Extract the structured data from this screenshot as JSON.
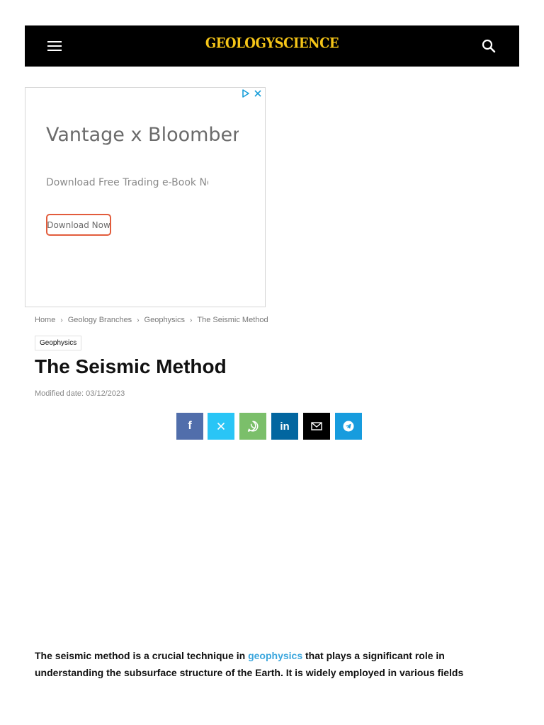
{
  "header": {
    "logo": "GEOLOGYSCIENCE",
    "menu_icon": "hamburger-menu-icon",
    "search_icon": "search-icon",
    "background": "#000000",
    "logo_color": "#f5c518"
  },
  "ad": {
    "title": "Vantage x Bloomberg Media Studios",
    "subtitle": "Download Free Trading e-Book Now",
    "button_label": "Download Now",
    "adchoices_icon": "adchoices-icon",
    "close_icon": "close-icon",
    "accent_color": "#e25c3c"
  },
  "breadcrumb": {
    "items": [
      "Home",
      "Geology Branches",
      "Geophysics",
      "The Seismic Method"
    ],
    "separator_icon": "chevron-right-icon"
  },
  "article": {
    "category": "Geophysics",
    "title": "The Seismic Method",
    "modified": "Modified date: 03/12/2023",
    "intro_before_link": "The seismic method is a crucial technique in ",
    "intro_link": "geophysics",
    "intro_after_link": " that plays a significant role in understanding the subsurface structure of the Earth. It is widely employed in various fields"
  },
  "share": [
    {
      "network": "facebook",
      "icon": "facebook-icon",
      "glyph": "f",
      "color": "#516eab"
    },
    {
      "network": "x",
      "icon": "x-icon",
      "glyph": "𝕏",
      "color": "#29c5f6"
    },
    {
      "network": "whatsapp",
      "icon": "whatsapp-icon",
      "glyph": "",
      "color": "#7bbf6a"
    },
    {
      "network": "linkedin",
      "icon": "linkedin-icon",
      "glyph": "in",
      "color": "#0266a0"
    },
    {
      "network": "email",
      "icon": "email-icon",
      "glyph": "",
      "color": "#000000"
    },
    {
      "network": "telegram",
      "icon": "telegram-icon",
      "glyph": "",
      "color": "#179cde"
    }
  ]
}
